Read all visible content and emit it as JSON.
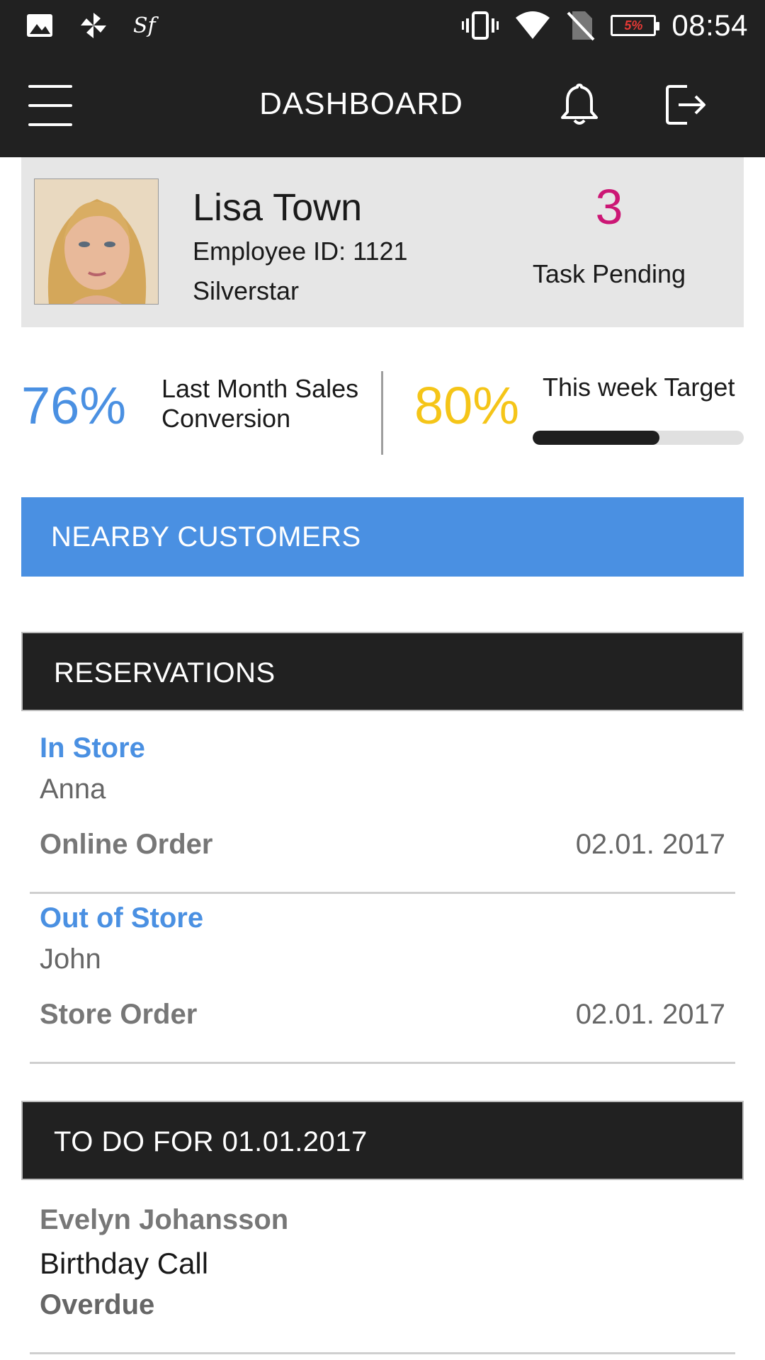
{
  "status_bar": {
    "icons_left": [
      "image-icon",
      "pinwheel-icon",
      "sf-icon"
    ],
    "sf_glyph": "Sf",
    "icons_right": [
      "vibrate-icon",
      "wifi-icon",
      "no-sim-icon",
      "battery-icon"
    ],
    "battery_text": "5%",
    "time": "08:54"
  },
  "header": {
    "title": "DASHBOARD",
    "menu_icon": "hamburger-menu-icon",
    "notification_icon": "bell-icon",
    "logout_icon": "logout-icon"
  },
  "profile": {
    "name": "Lisa Town",
    "employee_id": "Employee ID: 1121",
    "company": "Silverstar",
    "task_count": "3",
    "task_label": "Task Pending"
  },
  "stats": {
    "conversion_percent": "76%",
    "conversion_label_line1": "Last Month Sales",
    "conversion_label_line2": "Conversion",
    "target_percent": "80%",
    "target_label": "This week Target",
    "target_progress_fraction": 0.6
  },
  "nearby": {
    "label": "NEARBY CUSTOMERS"
  },
  "reservations": {
    "title": "RESERVATIONS",
    "items": [
      {
        "type": "In Store",
        "customer": "Anna",
        "order": "Online Order",
        "date": "02.01. 2017"
      },
      {
        "type": "Out of Store",
        "customer": "John",
        "order": "Store Order",
        "date": "02.01. 2017"
      }
    ]
  },
  "todo": {
    "title": "TO DO FOR 01.01.2017",
    "items": [
      {
        "name": "Evelyn Johansson",
        "task": "Birthday Call",
        "status": "Overdue"
      }
    ]
  },
  "colors": {
    "accent_blue": "#4a90e2",
    "task_magenta": "#cc1775",
    "target_yellow": "#f5c518",
    "dark_bar": "#212121"
  }
}
